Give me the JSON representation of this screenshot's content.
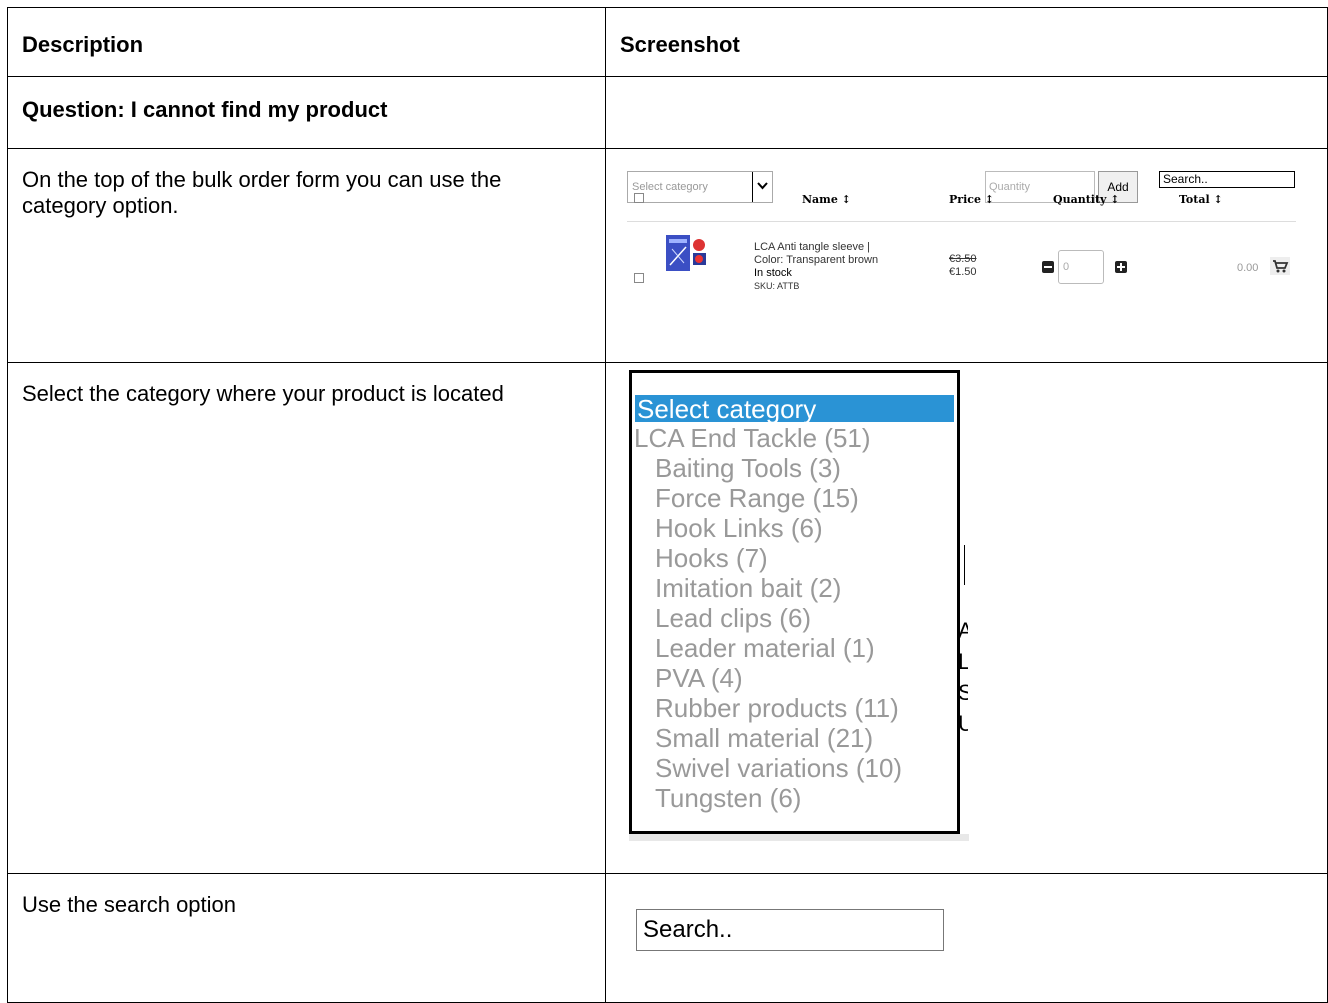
{
  "header": {
    "description": "Description",
    "screenshot": "Screenshot"
  },
  "question": "Question: I cannot find my product",
  "rows": [
    {
      "description": "On the top of the bulk order form you can use the category option."
    },
    {
      "description": "Select the category where your product is located"
    },
    {
      "description": "Use the search option"
    }
  ],
  "bulk_form": {
    "category_placeholder": "Select category",
    "quantity_placeholder": "Quantity",
    "add_label": "Add",
    "search_placeholder": "Search..",
    "columns": {
      "name": "Name ↕",
      "price": "Price ↕",
      "quantity": "Quantity ↕",
      "total": "Total ↕"
    },
    "product": {
      "name_line1": "LCA Anti tangle sleeve |",
      "name_line2": "Color: Transparent brown",
      "stock": "In stock",
      "sku": "SKU: ATTB",
      "price_old": "€3.50",
      "price_new": "€1.50",
      "quantity": "0",
      "total": "0.00"
    }
  },
  "category_dropdown": {
    "selected": "Select category",
    "items": [
      {
        "label": "LCA End Tackle  (51)",
        "level": 0
      },
      {
        "label": "Baiting Tools  (3)",
        "level": 1
      },
      {
        "label": "Force Range  (15)",
        "level": 1
      },
      {
        "label": "Hook Links  (6)",
        "level": 1
      },
      {
        "label": "Hooks  (7)",
        "level": 1
      },
      {
        "label": "Imitation bait  (2)",
        "level": 1
      },
      {
        "label": "Lead clips  (6)",
        "level": 1
      },
      {
        "label": "Leader material  (1)",
        "level": 1
      },
      {
        "label": "PVA  (4)",
        "level": 1
      },
      {
        "label": "Rubber products  (11)",
        "level": 1
      },
      {
        "label": "Small material  (21)",
        "level": 1
      },
      {
        "label": "Swivel variations  (10)",
        "level": 1
      },
      {
        "label": "Tungsten  (6)",
        "level": 1
      }
    ]
  },
  "search_box": {
    "placeholder": "Search.."
  },
  "colors": {
    "dropdown_highlight": "#2a93d5",
    "muted_text": "#999999"
  },
  "icons": [
    "chevron-down-icon",
    "sort-icon",
    "minus-icon",
    "plus-icon",
    "cart-icon"
  ]
}
